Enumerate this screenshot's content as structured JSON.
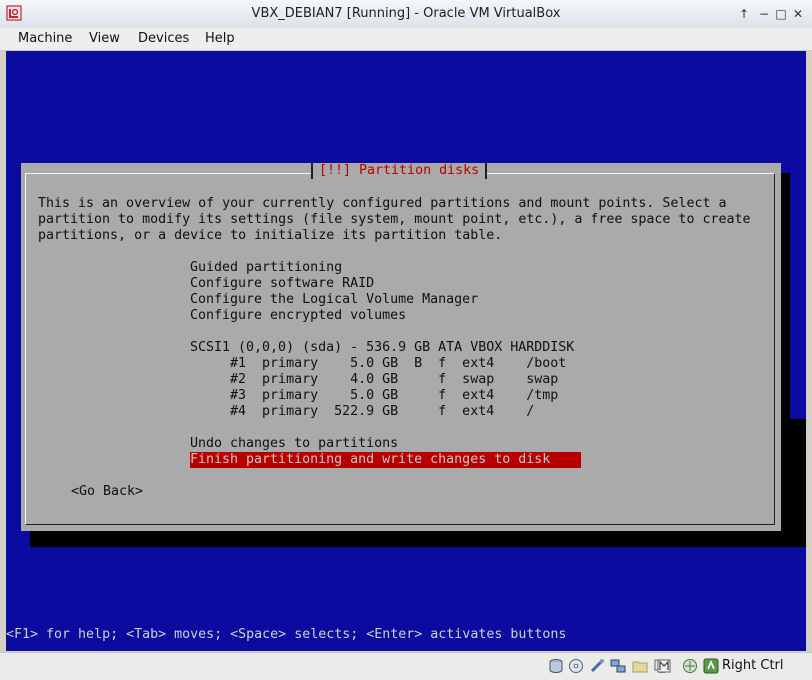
{
  "window": {
    "title": "VBX_DEBIAN7 [Running] - Oracle VM VirtualBox",
    "buttons": [
      "↑",
      "−",
      "□",
      "✕"
    ]
  },
  "menu": [
    "Machine",
    "View",
    "Devices",
    "Help"
  ],
  "installer": {
    "dialog_title": "[!!] Partition disks",
    "intro": [
      "This is an overview of your currently configured partitions and mount points. Select a",
      "partition to modify its settings (file system, mount point, etc.), a free space to create",
      "partitions, or a device to initialize its partition table."
    ],
    "options": [
      "Guided partitioning",
      "Configure software RAID",
      "Configure the Logical Volume Manager",
      "Configure encrypted volumes"
    ],
    "disk": "SCSI1 (0,0,0) (sda) - 536.9 GB ATA VBOX HARDDISK",
    "partitions": [
      "     #1  primary    5.0 GB  B  f  ext4    /boot",
      "     #2  primary    4.0 GB     f  swap    swap",
      "     #3  primary    5.0 GB     f  ext4    /tmp",
      "     #4  primary  522.9 GB     f  ext4    /"
    ],
    "undo": "Undo changes to partitions",
    "finish": "Finish partitioning and write changes to disk",
    "go_back": "<Go Back>",
    "help_line": "<F1> for help; <Tab> moves; <Space> selects; <Enter> activates buttons"
  },
  "statusbar": {
    "icons": [
      "hard-disk-icon",
      "optical-drive-icon",
      "usb-icon",
      "network-icon",
      "shared-folders-icon",
      "display-icon",
      "video-capture-icon",
      "mouse-integration-icon",
      "host-key-icon"
    ],
    "host_key": "Right Ctrl"
  }
}
